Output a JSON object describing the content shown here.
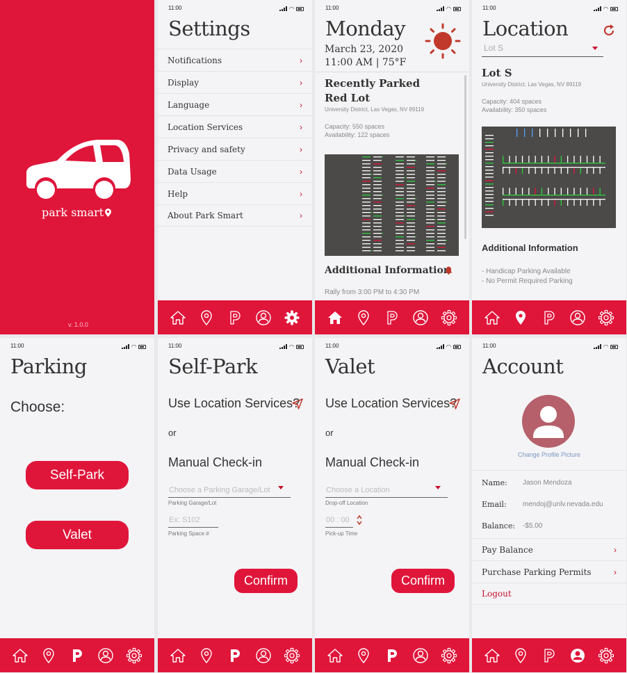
{
  "status": {
    "time": "11:00"
  },
  "splash": {
    "app_name": "park smart",
    "version": "v. 1.0.0"
  },
  "settings": {
    "title": "Settings",
    "items": [
      "Notifications",
      "Display",
      "Language",
      "Location Services",
      "Privacy and safety",
      "Data Usage",
      "Help",
      "About Park Smart"
    ]
  },
  "home": {
    "day": "Monday",
    "date": "March 23, 2020",
    "time_weather": "11:00 AM | 75°F",
    "recent_heading": "Recently Parked",
    "lot_name": "Red Lot",
    "address": "University District, Las Vegas, NV 89119",
    "capacity": "Capacity: 550 spaces",
    "availability": "Availability: 122 spaces",
    "additional_heading": "Additional Information",
    "event": "Rally from 3:00 PM to 4:30 PM"
  },
  "location": {
    "title": "Location",
    "select_value": "Lot S",
    "lot_name": "Lot S",
    "address": "University District, Las Vegas, NV 89119",
    "capacity": "Capacity: 404 spaces",
    "availability": "Availability: 350 spaces",
    "additional_heading": "Additional Information",
    "info1": "- Handicap Parking Available",
    "info2": "- No Permit Required Parking"
  },
  "parking": {
    "title": "Parking",
    "choose": "Choose:",
    "selfpark_btn": "Self-Park",
    "valet_btn": "Valet"
  },
  "selfpark": {
    "title": "Self-Park",
    "use_location": "Use Location Services?",
    "or": "or",
    "manual": "Manual Check-in",
    "garage_placeholder": "Choose a Parking Garage/Lot",
    "garage_label": "Parking Garage/Lot",
    "space_placeholder": "Ex: S102",
    "space_label": "Parking Space #",
    "confirm": "Confirm"
  },
  "valet": {
    "title": "Valet",
    "use_location": "Use Location Services?",
    "or": "or",
    "manual": "Manual Check-in",
    "location_placeholder": "Choose a Location",
    "location_label": "Drop-off Location",
    "time_placeholder": "00 : 00",
    "time_label": "Pick-up Time",
    "confirm": "Confirm"
  },
  "account": {
    "title": "Account",
    "change_pic": "Change Profile Picture",
    "name_label": "Name:",
    "name_value": "Jason Mendoza",
    "email_label": "Email:",
    "email_value": "mendoj@unlv.nevada.edu",
    "balance_label": "Balance:",
    "balance_value": "-$5.00",
    "pay_balance": "Pay Balance",
    "purchase": "Purchase Parking Permits",
    "logout": "Logout"
  },
  "colors": {
    "brand_red": "#e0153a",
    "avatar": "#b5606a",
    "lot_bg": "#4b4a48",
    "sun": "#c0392b"
  }
}
